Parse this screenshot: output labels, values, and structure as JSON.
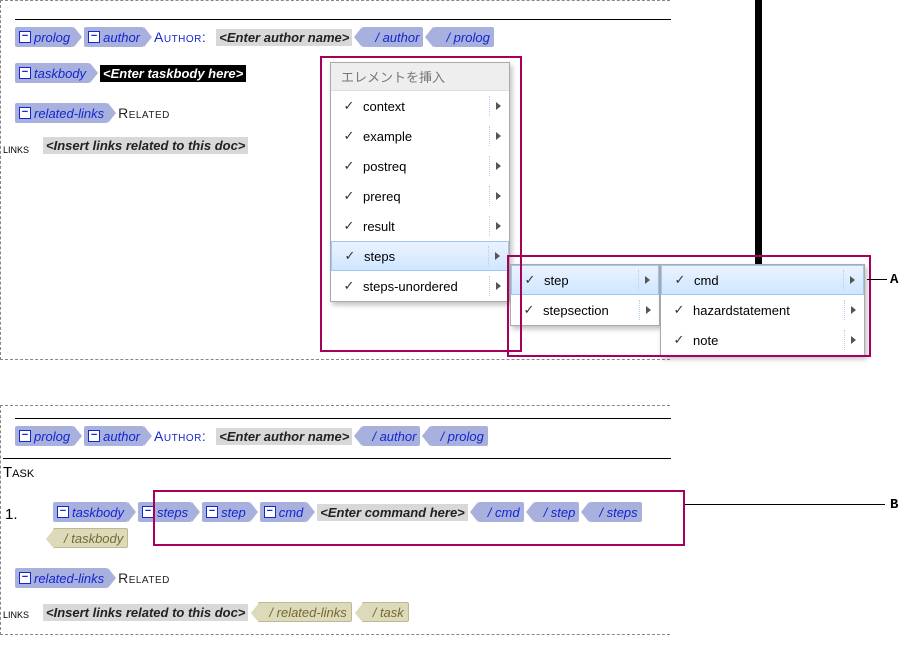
{
  "colors": {
    "tag_bg": "#a8b1dd",
    "tag_text": "#1425d1",
    "callout": "#a6005a"
  },
  "section1": {
    "row_author": {
      "prolog_open": "prolog",
      "author_open": "author",
      "author_label": "Author:",
      "placeholder": "<Enter author name>",
      "author_close": "/ author",
      "prolog_close": "/ prolog"
    },
    "row_taskbody": {
      "taskbody_open": "taskbody",
      "placeholder": "<Enter taskbody here>"
    },
    "row_related": {
      "related_open": "related-links",
      "related_label": "Related",
      "links_label": "links",
      "placeholder": "<Insert links related to this doc>"
    }
  },
  "menu": {
    "title": "エレメントを挿入",
    "items": [
      {
        "label": "context",
        "selected": false
      },
      {
        "label": "example",
        "selected": false
      },
      {
        "label": "postreq",
        "selected": false
      },
      {
        "label": "prereq",
        "selected": false
      },
      {
        "label": "result",
        "selected": false
      },
      {
        "label": "steps",
        "selected": true
      },
      {
        "label": "steps-unordered",
        "selected": false
      }
    ],
    "sub1": [
      {
        "label": "step",
        "selected": true
      },
      {
        "label": "stepsection",
        "selected": false
      }
    ],
    "sub2": [
      {
        "label": "cmd",
        "selected": true
      },
      {
        "label": "hazardstatement",
        "selected": false
      },
      {
        "label": "note",
        "selected": false
      }
    ]
  },
  "section2": {
    "row_author": {
      "prolog_open": "prolog",
      "author_open": "author",
      "author_label": "Author:",
      "placeholder": "<Enter author name>",
      "author_close": "/ author",
      "prolog_close": "/ prolog"
    },
    "task_label": "Task",
    "num": "1.",
    "row_cmd": {
      "taskbody_open": "taskbody",
      "steps_open": "steps",
      "step_open": "step",
      "cmd_open": "cmd",
      "placeholder": "<Enter command here>",
      "cmd_close": "/ cmd",
      "step_close": "/ step",
      "steps_close": "/ steps",
      "taskbody_close": "/ taskbody"
    },
    "row_related": {
      "related_open": "related-links",
      "related_label": "Related",
      "links_label": "links",
      "placeholder": "<Insert links related to this doc>",
      "related_close": "/ related-links",
      "task_close": "/ task"
    }
  },
  "callouts": {
    "a": "A",
    "b": "B"
  }
}
